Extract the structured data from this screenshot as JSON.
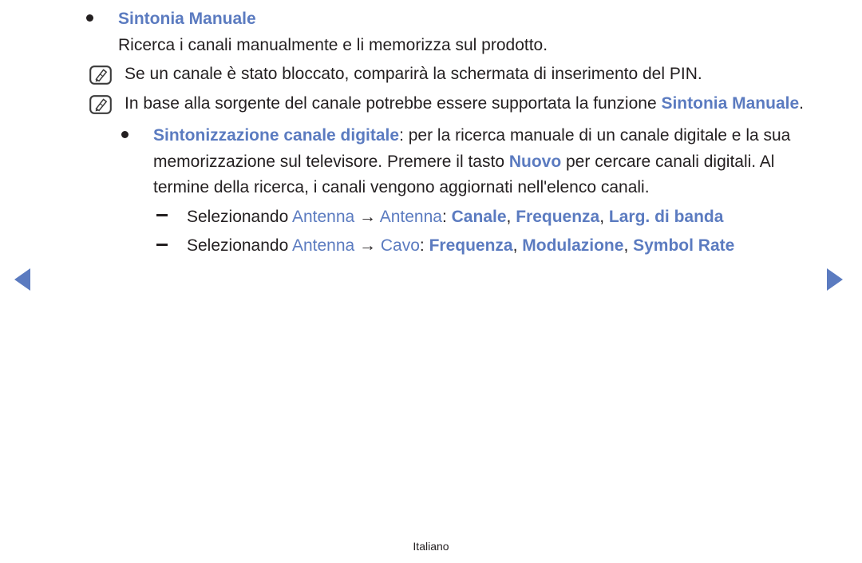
{
  "page": {
    "language_footer": "Italiano",
    "accent_color": "#5b7bc0",
    "text_color": "#231f20",
    "background_color": "#ffffff"
  },
  "nav": {
    "prev_label": "◀",
    "prev_icon": "triangle-left-icon",
    "next_label": "▶",
    "next_icon": "triangle-right-icon"
  },
  "content": {
    "section_title": "Sintonia Manuale",
    "section_description": "Ricerca i canali manualmente e li memorizza sul prodotto.",
    "notes": [
      {
        "icon": "note-pencil-icon",
        "text": "Se un canale è stato bloccato, comparirà la schermata di inserimento del PIN."
      },
      {
        "icon": "note-pencil-icon",
        "prefix": "In base alla sorgente del canale potrebbe essere supportata la funzione ",
        "highlight": "Sintonia Manuale",
        "suffix": "."
      }
    ],
    "digital_item": {
      "term": "Sintonizzazione canale digitale",
      "colon": ": ",
      "body_1": "per la ricerca manuale di un canale digitale e la sua memorizzazione sul televisore. Premere il tasto ",
      "key": "Nuovo",
      "body_2": " per cercare canali digitali. Al termine della ricerca, i canali vengono aggiornati nell'elenco canali."
    },
    "sub_items": [
      {
        "marker": "–",
        "lead": "Selezionando ",
        "path_1": "Antenna",
        "arrow": " → ",
        "path_2": "Antenna",
        "colon": ": ",
        "fields": [
          "Canale",
          "Frequenza",
          "Larg. di banda"
        ]
      },
      {
        "marker": "–",
        "lead": "Selezionando ",
        "path_1": "Antenna",
        "arrow": " → ",
        "path_2": "Cavo",
        "colon": ": ",
        "fields": [
          "Frequenza",
          "Modulazione",
          "Symbol Rate"
        ]
      }
    ]
  }
}
